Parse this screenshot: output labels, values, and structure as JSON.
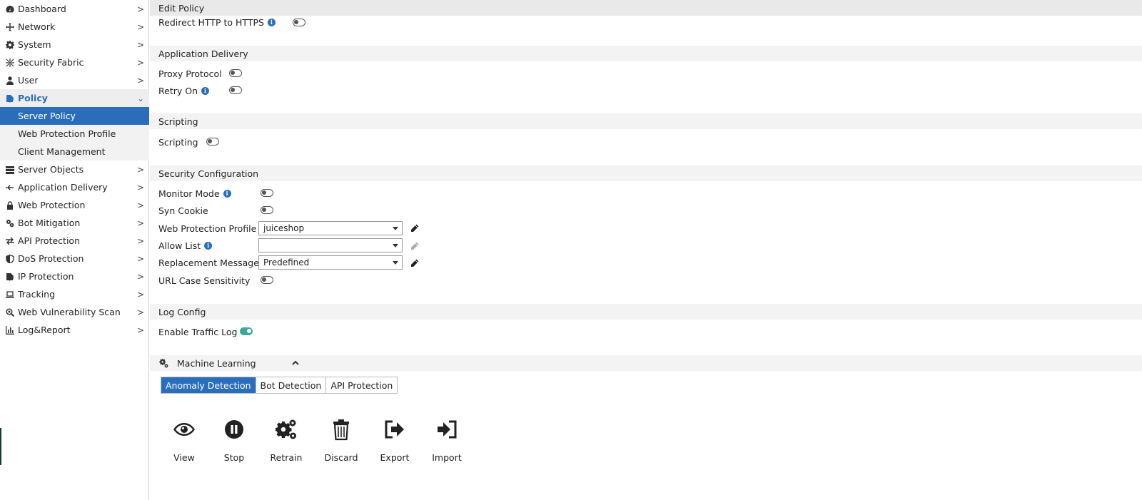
{
  "sidebar": {
    "items": [
      {
        "label": "Dashboard",
        "icon": "dashboard-icon"
      },
      {
        "label": "Network",
        "icon": "network-icon"
      },
      {
        "label": "System",
        "icon": "gear-icon"
      },
      {
        "label": "Security Fabric",
        "icon": "security-fabric-icon"
      },
      {
        "label": "User",
        "icon": "user-icon"
      },
      {
        "label": "Policy",
        "icon": "policy-icon"
      },
      {
        "label": "Server Objects",
        "icon": "server-objects-icon"
      },
      {
        "label": "Application Delivery",
        "icon": "application-delivery-icon"
      },
      {
        "label": "Web Protection",
        "icon": "lock-icon"
      },
      {
        "label": "Bot Mitigation",
        "icon": "bot-mitigation-icon"
      },
      {
        "label": "API Protection",
        "icon": "api-protection-icon"
      },
      {
        "label": "DoS Protection",
        "icon": "shield-icon"
      },
      {
        "label": "IP Protection",
        "icon": "ip-protection-icon"
      },
      {
        "label": "Tracking",
        "icon": "laptop-icon"
      },
      {
        "label": "Web Vulnerability Scan",
        "icon": "scan-icon"
      },
      {
        "label": "Log&Report",
        "icon": "chart-icon"
      }
    ],
    "policy_subitems": [
      {
        "label": "Server Policy",
        "active": true
      },
      {
        "label": "Web Protection Profile",
        "active": false
      },
      {
        "label": "Client Management",
        "active": false
      }
    ]
  },
  "main": {
    "edit_policy": {
      "title": "Edit Policy",
      "redirect_label": "Redirect HTTP to HTTPS"
    },
    "application_delivery": {
      "title": "Application Delivery",
      "proxy_protocol_label": "Proxy Protocol",
      "retry_on_label": "Retry On"
    },
    "scripting": {
      "title": "Scripting",
      "scripting_label": "Scripting"
    },
    "security_configuration": {
      "title": "Security Configuration",
      "monitor_mode_label": "Monitor Mode",
      "syn_cookie_label": "Syn Cookie",
      "web_protection_profile_label": "Web Protection Profile",
      "web_protection_profile_value": "juiceshop",
      "allow_list_label": "Allow List",
      "allow_list_value": "",
      "replacement_message_label": "Replacement Message",
      "replacement_message_value": "Predefined",
      "url_case_label": "URL Case Sensitivity"
    },
    "log_config": {
      "title": "Log Config",
      "enable_traffic_log_label": "Enable Traffic Log",
      "enable_traffic_log_on": true
    },
    "machine_learning": {
      "title": "Machine Learning",
      "tabs": [
        "Anomaly Detection",
        "Bot Detection",
        "API Protection"
      ],
      "active_tab": "Anomaly Detection",
      "actions": [
        {
          "label": "View",
          "icon": "eye-icon"
        },
        {
          "label": "Stop",
          "icon": "pause-icon"
        },
        {
          "label": "Retrain",
          "icon": "gears-icon"
        },
        {
          "label": "Discard",
          "icon": "trash-icon"
        },
        {
          "label": "Export",
          "icon": "export-icon"
        },
        {
          "label": "Import",
          "icon": "import-icon"
        }
      ]
    }
  },
  "colors": {
    "accent": "#2a6ebb",
    "toggle_on": "#3aa89a"
  }
}
